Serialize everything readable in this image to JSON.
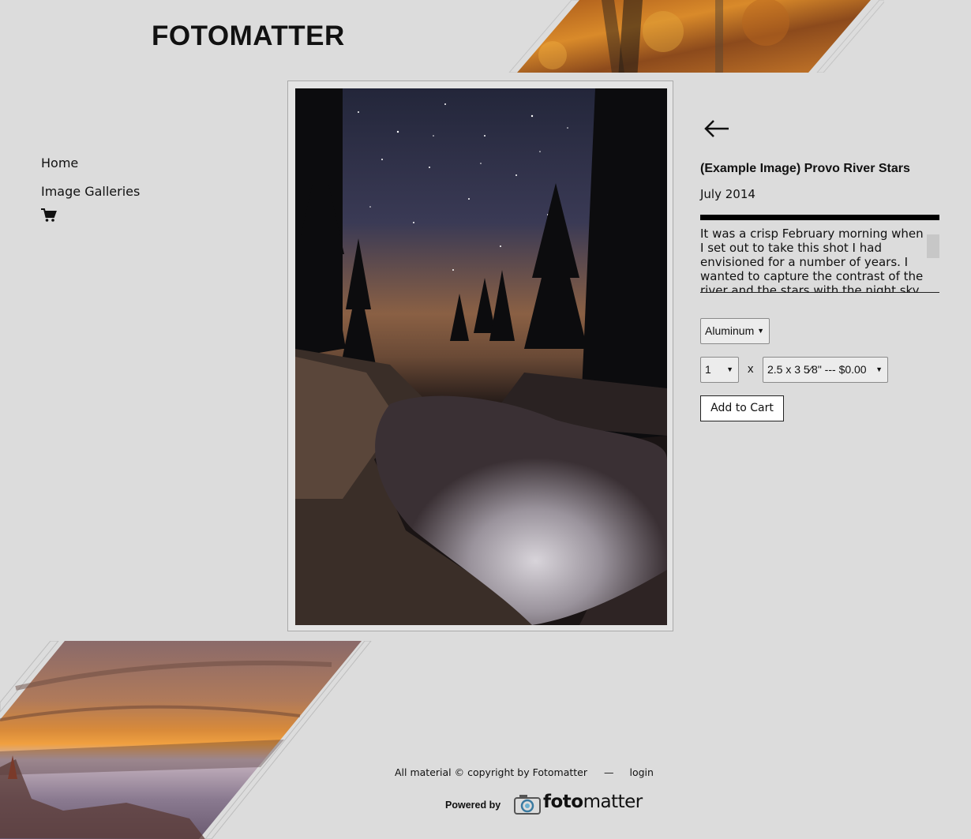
{
  "site": {
    "logo": "FOTOMATTER"
  },
  "nav": {
    "items": [
      {
        "label": "Home"
      },
      {
        "label": "Image Galleries"
      }
    ],
    "cart_icon": "cart-icon"
  },
  "image": {
    "title": "(Example Image) Provo River Stars",
    "date": "July 2014",
    "description": "It was a crisp February morning when I set out to take this shot I had envisioned for a number of years. I wanted to capture the contrast of the river and the stars with the night sky",
    "back_icon": "back-arrow-icon"
  },
  "purchase": {
    "material": "Aluminum",
    "quantity": "1",
    "times": "x",
    "size": "2.5 x 3 5⁄8\" --- $0.00",
    "add_to_cart": "Add to Cart"
  },
  "footer": {
    "copyright": "All material © copyright by Fotomatter",
    "separator": "—",
    "login": "login",
    "powered_by": "Powered by",
    "brand_a": "foto",
    "brand_b": "matter"
  },
  "colors": {
    "background": "#dcdcdc",
    "text": "#111111"
  }
}
